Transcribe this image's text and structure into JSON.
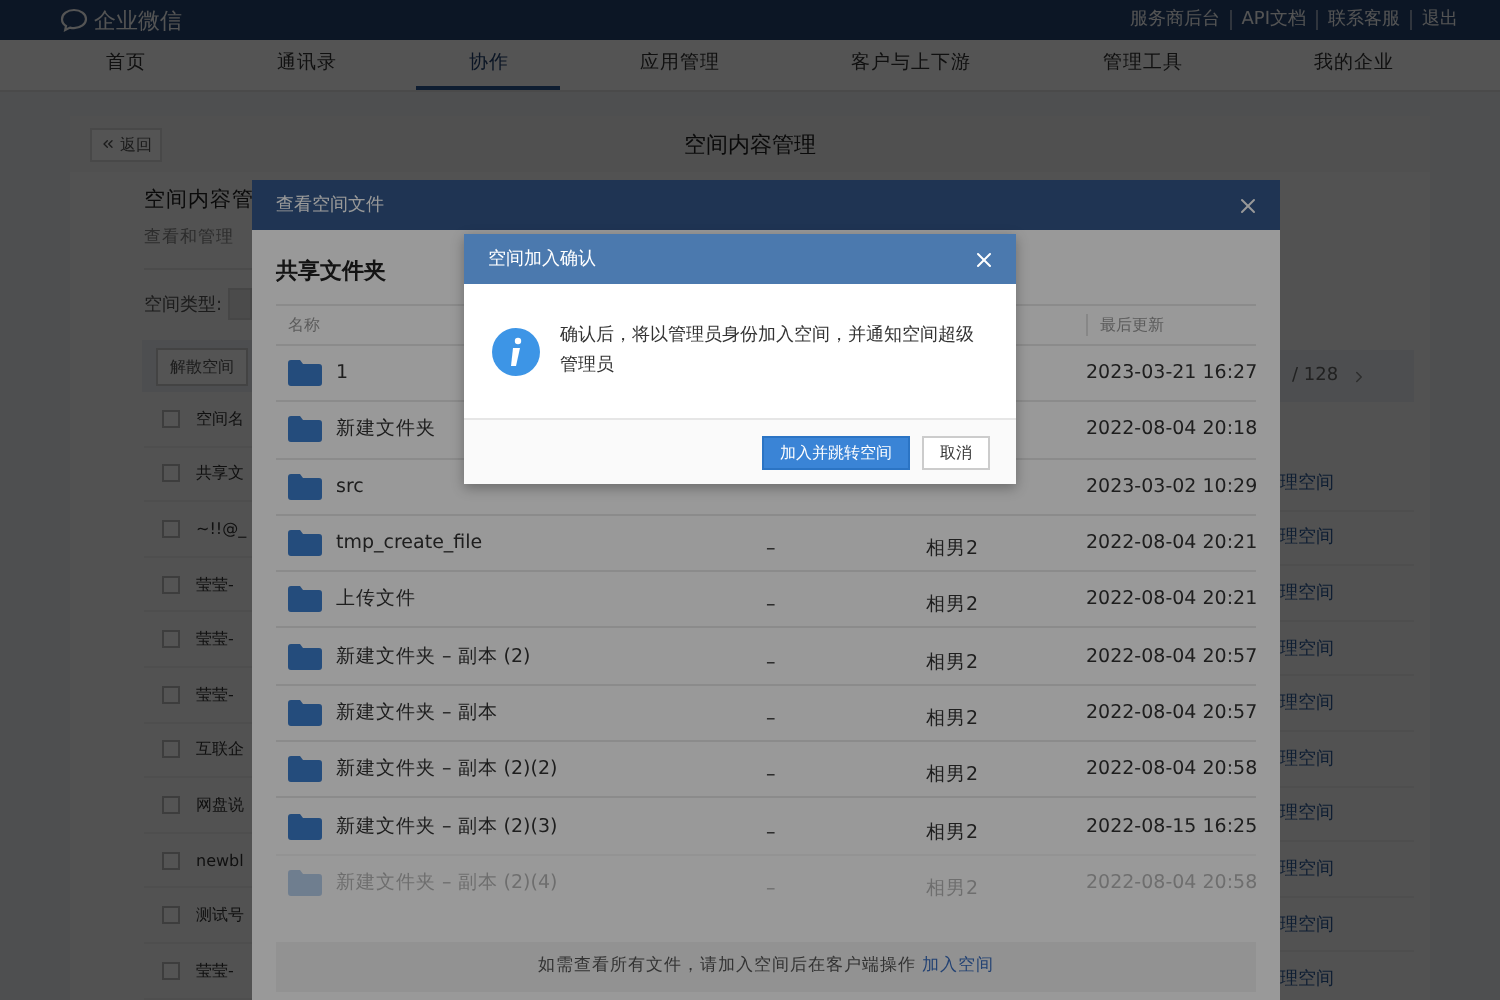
{
  "top_bar": {
    "logo_text": "企业微信",
    "links": [
      "服务商后台",
      "API文档",
      "联系客服",
      "退出"
    ]
  },
  "nav": {
    "tabs": [
      {
        "label": "首页",
        "selected": false
      },
      {
        "label": "通讯录",
        "selected": false
      },
      {
        "label": "协作",
        "selected": true
      },
      {
        "label": "应用管理",
        "selected": false
      },
      {
        "label": "客户与上下游",
        "selected": false
      },
      {
        "label": "管理工具",
        "selected": false
      },
      {
        "label": "我的企业",
        "selected": false
      }
    ]
  },
  "page": {
    "back_button": "返回",
    "title": "空间内容管理",
    "heading": "空间内容管",
    "subheading": "查看和管理",
    "filter_label": "空间类型:",
    "action_button": "解散空间",
    "pagination": "/ 128",
    "table": {
      "column_1": "空间名",
      "header_checked": false,
      "rows": [
        {
          "name": "共享文",
          "action": "理空间",
          "checked": false
        },
        {
          "name": "~!!@_",
          "action": "理空间",
          "checked": false
        },
        {
          "name": "莹莹-",
          "action": "理空间",
          "checked": false
        },
        {
          "name": "莹莹-",
          "action": "理空间",
          "checked": false
        },
        {
          "name": "莹莹-",
          "action": "理空间",
          "checked": false
        },
        {
          "name": "互联企",
          "action": "理空间",
          "checked": false
        },
        {
          "name": "网盘说",
          "action": "理空间",
          "checked": false
        },
        {
          "name": "newbl",
          "action": "理空间",
          "checked": false
        },
        {
          "name": "测试号",
          "action": "理空间",
          "checked": false
        },
        {
          "name": "莹莹-",
          "action": "理空间",
          "checked": false
        }
      ]
    }
  },
  "file_dialog": {
    "title": "查看空间文件",
    "section_title": "共享文件夹",
    "columns": {
      "name": "名称",
      "updated": "最后更新"
    },
    "rows": [
      {
        "name": "1",
        "updated": "2023-03-21 16:27",
        "faded": false
      },
      {
        "name": "新建文件夹",
        "updated": "2022-08-04 20:18",
        "faded": false
      },
      {
        "name": "src",
        "updated": "2023-03-02 10:29",
        "faded": false
      },
      {
        "name": "tmp_create_file",
        "column_2": "–",
        "column_3": "相男2",
        "updated": "2022-08-04 20:21",
        "faded": false
      },
      {
        "name": "上传文件",
        "column_2": "–",
        "column_3": "相男2",
        "updated": "2022-08-04 20:21",
        "faded": false
      },
      {
        "name": "新建文件夹 – 副本 (2)",
        "column_2": "–",
        "column_3": "相男2",
        "updated": "2022-08-04 20:57",
        "faded": false
      },
      {
        "name": "新建文件夹 – 副本",
        "column_2": "–",
        "column_3": "相男2",
        "updated": "2022-08-04 20:57",
        "faded": false
      },
      {
        "name": "新建文件夹 – 副本 (2)(2)",
        "column_2": "–",
        "column_3": "相男2",
        "updated": "2022-08-04 20:58",
        "faded": false
      },
      {
        "name": "新建文件夹 – 副本 (2)(3)",
        "column_2": "–",
        "column_3": "相男2",
        "updated": "2022-08-15 16:25",
        "faded": false
      },
      {
        "name": "新建文件夹 – 副本 (2)(4)",
        "column_2": "–",
        "column_3": "相男2",
        "updated": "2022-08-04 20:58",
        "faded": true
      }
    ],
    "footer": {
      "text": "如需查看所有文件，请加入空间后在客户端操作",
      "link": "加入空间"
    }
  },
  "confirm_dialog": {
    "title": "空间加入确认",
    "message": "确认后，将以管理员身份加入空间，并通知空间超级管理员",
    "buttons": [
      {
        "label": "加入并跳转空间",
        "kind": "primary"
      },
      {
        "label": "取消",
        "kind": "default"
      }
    ]
  }
}
